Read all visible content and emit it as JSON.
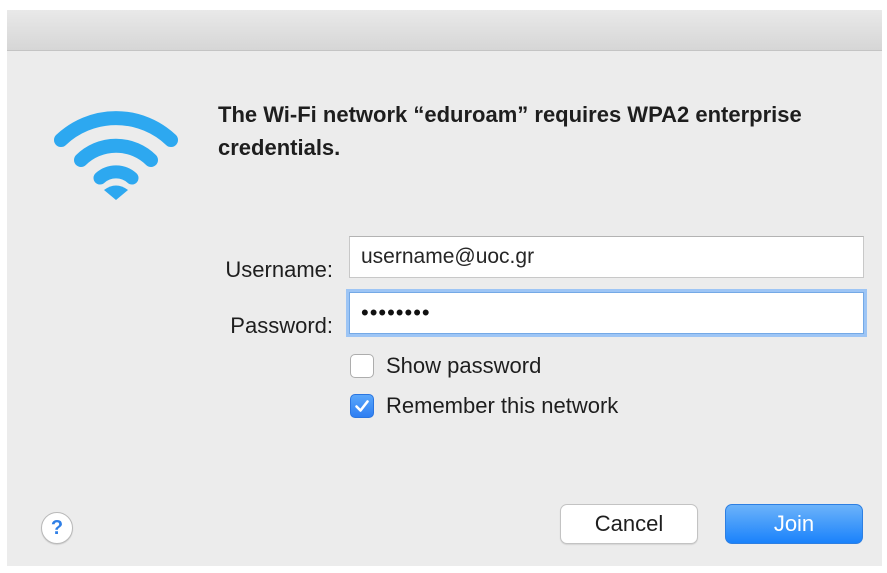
{
  "dialog": {
    "message": "The Wi-Fi network “eduroam” requires WPA2 enterprise credentials.",
    "icon": "wifi-icon",
    "accent_color": "#2da8f0"
  },
  "form": {
    "username_label": "Username:",
    "username_value": "username@uoc.gr",
    "password_label": "Password:",
    "password_masked": "••••••••",
    "show_password_label": "Show password",
    "show_password_checked": false,
    "remember_label": "Remember this network",
    "remember_checked": true
  },
  "buttons": {
    "help_label": "?",
    "cancel_label": "Cancel",
    "join_label": "Join",
    "join_color": "#1a82fb"
  }
}
